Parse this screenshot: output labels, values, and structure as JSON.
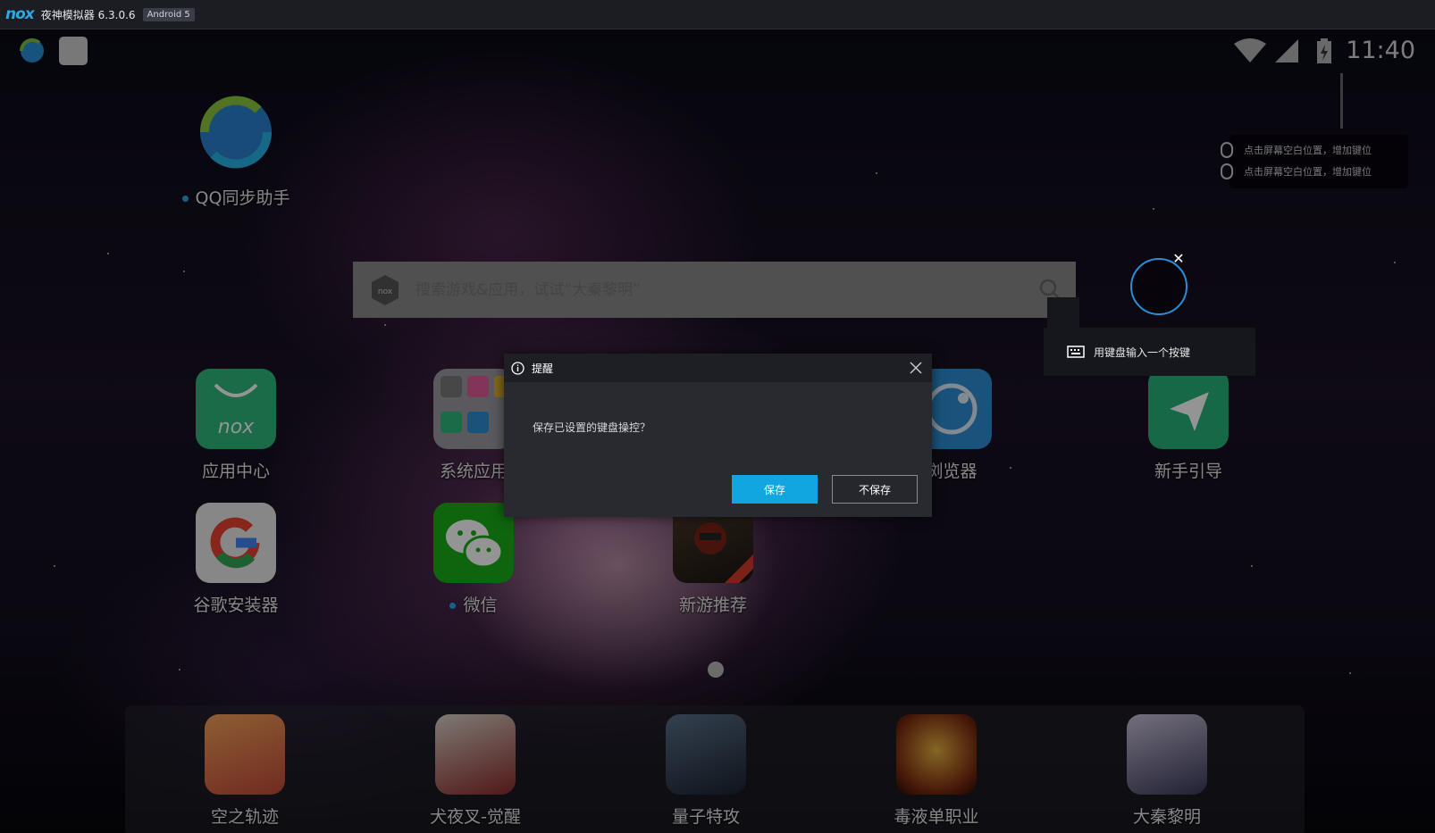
{
  "titlebar": {
    "logo": "nox",
    "title": "夜神模拟器 6.3.0.6",
    "android": "Android 5"
  },
  "status": {
    "time": "11:40",
    "left_icons": [
      "qq-sync-icon",
      "blank-app-icon"
    ],
    "right_icons": [
      "wifi-icon",
      "signal-icon",
      "battery-icon"
    ]
  },
  "hints": [
    "点击屏幕空白位置，增加键位",
    "点击屏幕空白位置，增加键位"
  ],
  "search": {
    "placeholder": "搜索游戏&应用，试试“大秦黎明”"
  },
  "apps": [
    {
      "label": "QQ同步助手",
      "new": true
    },
    {
      "label": "应用中心"
    },
    {
      "label": "系统应用"
    },
    {
      "label": "浏览器"
    },
    {
      "label": "新手引导"
    },
    {
      "label": "谷歌安装器"
    },
    {
      "label": "微信",
      "new": true
    },
    {
      "label": "新游推荐"
    }
  ],
  "dock": [
    {
      "label": "空之轨迹"
    },
    {
      "label": "犬夜叉-觉醒"
    },
    {
      "label": "量子特攻"
    },
    {
      "label": "毒液单职业"
    },
    {
      "label": "大秦黎明"
    }
  ],
  "keyboard_tip": "用键盘输入一个按键",
  "dialog": {
    "title": "提醒",
    "message": "保存已设置的键盘操控？",
    "save_label": "保存",
    "nosave_label": "不保存"
  },
  "colors": {
    "accent": "#12a6e0",
    "nox_blue": "#2aa8e8",
    "app_center_green": "#2fb87e",
    "guide_green": "#26b37a",
    "browser_blue": "#2c8fd6",
    "wechat_green": "#1aad19"
  }
}
